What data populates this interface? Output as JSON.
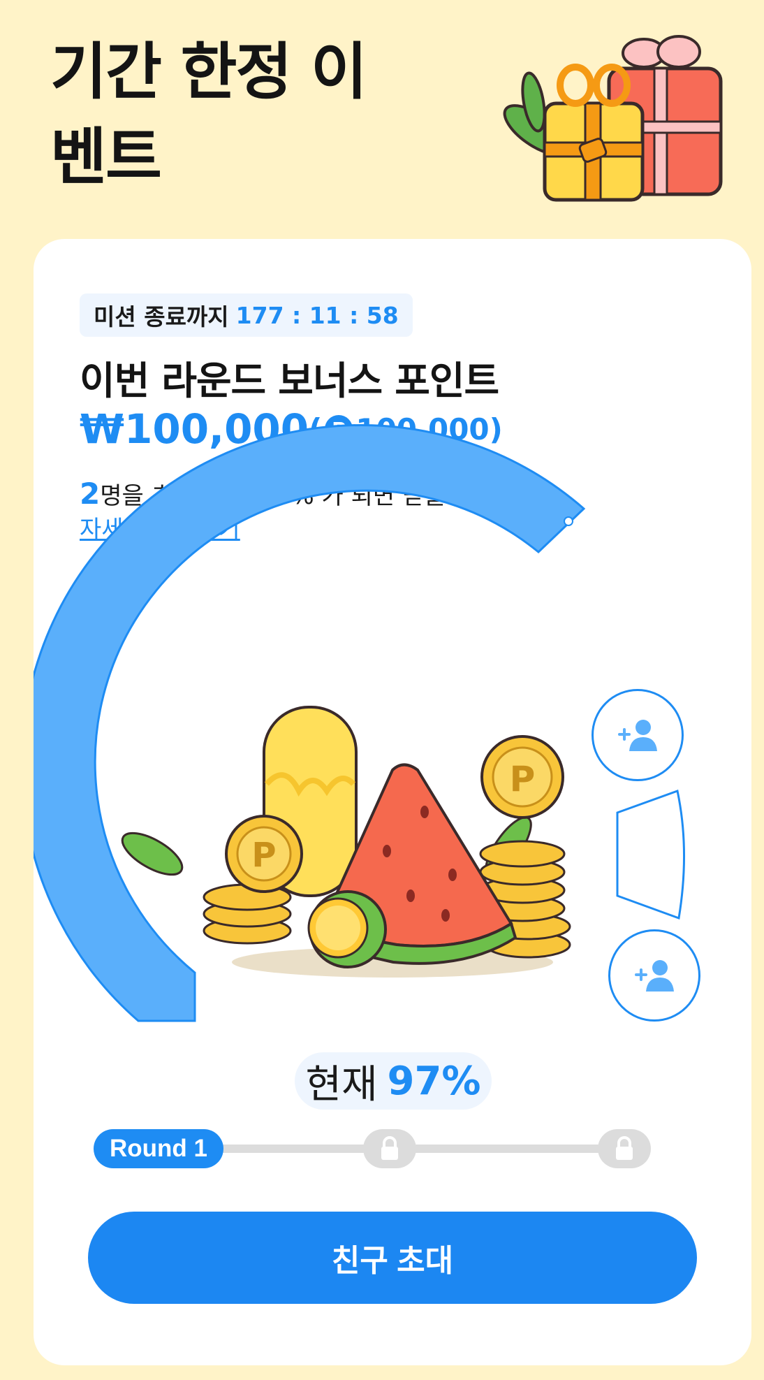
{
  "header": {
    "title": "기간 한정 이벤트"
  },
  "mission": {
    "timer_label": "미션 종료까지",
    "timer_value": "177 : 11 : 58",
    "round_title": "이번 라운드 보너스 포인트",
    "amount_won": "₩100,000",
    "amount_points_open": "(",
    "point_icon_letter": "P",
    "amount_points": "100,000)",
    "invite_count": "2",
    "invite_text": "명을 초대하고 100% 가 되면 받을 수 있어요",
    "learn_more": "자세히 알아보기"
  },
  "progress": {
    "current_label": "현재",
    "current_value": "97%",
    "percent": 97,
    "friend_slots_icon": "add-person-icon"
  },
  "rounds": {
    "active_label": "Round 1",
    "locked_icon": "lock-icon"
  },
  "actions": {
    "invite_button": "친구 초대"
  },
  "colors": {
    "background": "#FFF3C8",
    "accent": "#1E8CF3",
    "gauge_fill": "#5AAFFB"
  }
}
